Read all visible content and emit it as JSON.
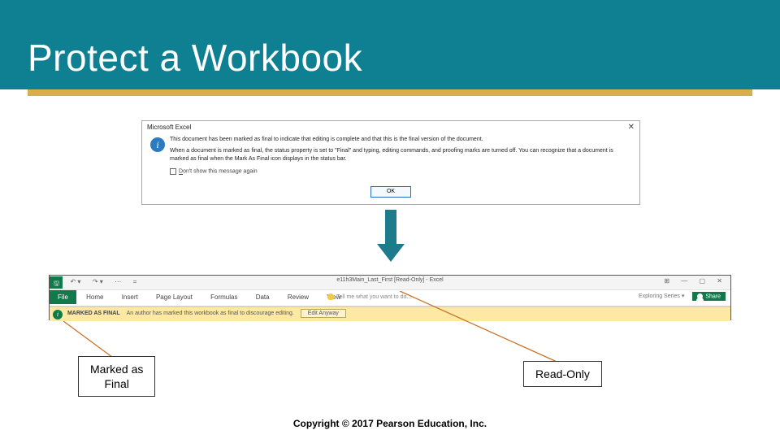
{
  "slide": {
    "title": "Protect a Workbook",
    "copyright": "Copyright © 2017 Pearson Education, Inc."
  },
  "dialog": {
    "app": "Microsoft Excel",
    "line1": "This document has been marked as final to indicate that editing is complete and that this is the final version of the document.",
    "line2": "When a document is marked as final, the status property is set to \"Final\" and typing, editing commands, and proofing marks are turned off. You can recognize that a document is marked as final when the Mark As Final icon displays in the status bar.",
    "checkbox_label": "on't show this message again",
    "checkbox_prefix": "D",
    "ok": "OK"
  },
  "ribbon": {
    "qat": {
      "save_glyph": "🖫",
      "undo": "↶ ▾",
      "redo": "↷ ▾",
      "more": "⋯",
      "sep": "="
    },
    "doc_title": "e11h3Main_Last_First [Read-Only] - Excel",
    "win": {
      "help": "?",
      "ctrls": "⊞  —  ▢  ✕"
    },
    "tabs": {
      "file": "File",
      "items": [
        "Home",
        "Insert",
        "Page Layout",
        "Formulas",
        "Data",
        "Review",
        "View"
      ],
      "tellme": "Tell me what you want to do...",
      "series": "Exploring Series ▾",
      "share": "Share"
    },
    "msgbar": {
      "badge": "i",
      "label": "MARKED AS FINAL",
      "desc": "An author has marked this workbook as final to discourage editing.",
      "button": "Edit Anyway"
    }
  },
  "callouts": {
    "left_line1": "Marked as",
    "left_line2": "Final",
    "right": "Read-Only"
  }
}
